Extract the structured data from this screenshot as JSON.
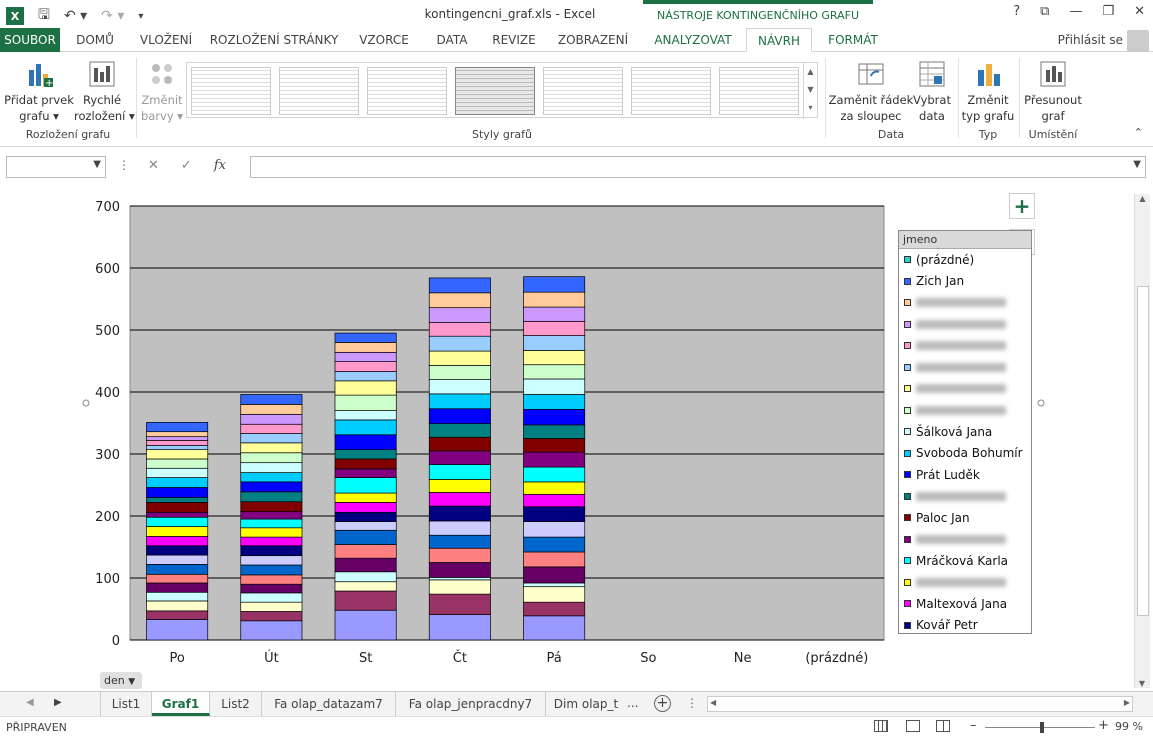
{
  "titlebar": {
    "doc_title": "kontingencni_graf.xls - Excel",
    "context_title": "NÁSTROJE KONTINGENČNÍHO GRAFU",
    "help": "?",
    "restore": "⧉",
    "minimize": "—",
    "maximize": "❐",
    "close": "✕"
  },
  "tabs": {
    "file": "SOUBOR",
    "items": [
      "DOMŮ",
      "VLOŽENÍ",
      "ROZLOŽENÍ STRÁNKY",
      "VZORCE",
      "DATA",
      "REVIZE",
      "ZOBRAZENÍ",
      "ANALYZOVAT",
      "NÁVRH",
      "FORMÁT"
    ],
    "signin": "Přihlásit se"
  },
  "ribbon": {
    "add_element": "Přidat prvek\ngrafu ▾",
    "quick_layout": "Rychlé\nrozložení ▾",
    "change_colors": "Změnit\nbarvy ▾",
    "switch_row_col": "Zaměnit řádek\nza sloupec",
    "select_data": "Vybrat\ndata",
    "change_type": "Změnit\ntyp grafu",
    "move_chart": "Přesunout\ngraf",
    "group_layout": "Rozložení grafu",
    "group_styles": "Styly grafů",
    "group_data": "Data",
    "group_type": "Typ",
    "group_location": "Umístění"
  },
  "formula_bar": {
    "name_box": "",
    "formula": ""
  },
  "chart_data": {
    "type": "bar",
    "stacked": true,
    "categories": [
      "Po",
      "Út",
      "St",
      "Čt",
      "Pá",
      "So",
      "Ne",
      "(prázdné)"
    ],
    "ylim": [
      0,
      700
    ],
    "yticks": [
      0,
      100,
      200,
      300,
      400,
      500,
      600,
      700
    ],
    "grid": true,
    "legend_title": "jmeno",
    "legend_placement": "right",
    "field_button": "den",
    "series": [
      {
        "name": "Kovář Petr",
        "color": "#9999ff",
        "values": [
          33,
          31,
          48,
          41,
          39,
          0,
          0,
          0
        ]
      },
      {
        "name": "",
        "color": "#993366",
        "values": [
          14,
          15,
          31,
          33,
          22,
          0,
          0,
          0
        ]
      },
      {
        "name": "",
        "color": "#ffffcc",
        "values": [
          16,
          15,
          15,
          23,
          25,
          0,
          0,
          0
        ]
      },
      {
        "name": "",
        "color": "#ccffff",
        "values": [
          14,
          15,
          16,
          4,
          6,
          0,
          0,
          0
        ]
      },
      {
        "name": "",
        "color": "#660066",
        "values": [
          15,
          14,
          22,
          24,
          26,
          0,
          0,
          0
        ]
      },
      {
        "name": "",
        "color": "#ff8080",
        "values": [
          14,
          15,
          22,
          23,
          24,
          0,
          0,
          0
        ]
      },
      {
        "name": "",
        "color": "#0066cc",
        "values": [
          16,
          16,
          23,
          21,
          24,
          0,
          0,
          0
        ]
      },
      {
        "name": "",
        "color": "#ccccff",
        "values": [
          15,
          15,
          14,
          23,
          25,
          0,
          0,
          0
        ]
      },
      {
        "name": "",
        "color": "#000080",
        "values": [
          15,
          16,
          15,
          24,
          24,
          0,
          0,
          0
        ]
      },
      {
        "name": "Maltexová Jana",
        "color": "#ff00ff",
        "values": [
          15,
          14,
          16,
          22,
          20,
          0,
          0,
          0
        ]
      },
      {
        "name": "",
        "color": "#ffff00",
        "values": [
          16,
          15,
          15,
          21,
          20,
          0,
          0,
          0
        ]
      },
      {
        "name": "Mráčková Karla",
        "color": "#00ffff",
        "values": [
          15,
          14,
          25,
          24,
          24,
          0,
          0,
          0
        ]
      },
      {
        "name": "",
        "color": "#800080",
        "values": [
          8,
          12,
          14,
          22,
          24,
          0,
          0,
          0
        ]
      },
      {
        "name": "Paloc Jan",
        "color": "#800000",
        "values": [
          16,
          16,
          16,
          22,
          22,
          0,
          0,
          0
        ]
      },
      {
        "name": "",
        "color": "#008080",
        "values": [
          8,
          16,
          15,
          22,
          22,
          0,
          0,
          0
        ]
      },
      {
        "name": "Prát Luděk",
        "color": "#0000ff",
        "values": [
          16,
          16,
          24,
          24,
          25,
          0,
          0,
          0
        ]
      },
      {
        "name": "Svoboda Bohumír",
        "color": "#00ccff",
        "values": [
          16,
          15,
          24,
          24,
          24,
          0,
          0,
          0
        ]
      },
      {
        "name": "Šálková Jana",
        "color": "#ccffff",
        "values": [
          15,
          16,
          15,
          23,
          25,
          0,
          0,
          0
        ]
      },
      {
        "name": "",
        "color": "#ccffcc",
        "values": [
          15,
          16,
          25,
          23,
          23,
          0,
          0,
          0
        ]
      },
      {
        "name": "",
        "color": "#ffff99",
        "values": [
          15,
          16,
          23,
          23,
          23,
          0,
          0,
          0
        ]
      },
      {
        "name": "",
        "color": "#99ccff",
        "values": [
          7,
          15,
          15,
          24,
          24,
          0,
          0,
          0
        ]
      },
      {
        "name": "",
        "color": "#ff99cc",
        "values": [
          8,
          15,
          16,
          22,
          23,
          0,
          0,
          0
        ]
      },
      {
        "name": "",
        "color": "#cc99ff",
        "values": [
          6,
          16,
          15,
          24,
          23,
          0,
          0,
          0
        ]
      },
      {
        "name": "",
        "color": "#ffcc99",
        "values": [
          8,
          16,
          16,
          24,
          24,
          0,
          0,
          0
        ]
      },
      {
        "name": "Zich Jan",
        "color": "#3366ff",
        "values": [
          15,
          16,
          15,
          24,
          25,
          0,
          0,
          0
        ]
      }
    ],
    "legend_entries": [
      {
        "name": "(prázdné)",
        "color": "#33cccc",
        "blurred": false
      },
      {
        "name": "Zich Jan",
        "color": "#3366ff",
        "blurred": false
      },
      {
        "name": "",
        "color": "#ffcc99",
        "blurred": true
      },
      {
        "name": "",
        "color": "#cc99ff",
        "blurred": true
      },
      {
        "name": "",
        "color": "#ff99cc",
        "blurred": true
      },
      {
        "name": "",
        "color": "#99ccff",
        "blurred": true
      },
      {
        "name": "",
        "color": "#ffff99",
        "blurred": true
      },
      {
        "name": "",
        "color": "#ccffcc",
        "blurred": true
      },
      {
        "name": "Šálková Jana",
        "color": "#ccffff",
        "blurred": false
      },
      {
        "name": "Svoboda Bohumír",
        "color": "#00ccff",
        "blurred": false
      },
      {
        "name": "Prát Luděk",
        "color": "#0000ff",
        "blurred": false
      },
      {
        "name": "",
        "color": "#008080",
        "blurred": true
      },
      {
        "name": "Paloc Jan",
        "color": "#800000",
        "blurred": false
      },
      {
        "name": "",
        "color": "#800080",
        "blurred": true
      },
      {
        "name": "Mráčková Karla",
        "color": "#00ffff",
        "blurred": false
      },
      {
        "name": "",
        "color": "#ffff00",
        "blurred": true
      },
      {
        "name": "Maltexová Jana",
        "color": "#ff00ff",
        "blurred": false
      },
      {
        "name": "Kovář Petr",
        "color": "#000080",
        "blurred": false
      }
    ]
  },
  "sheet_tabs": {
    "tabs": [
      "List1",
      "Graf1",
      "List2",
      "Fa olap_datazam7",
      "Fa olap_jenpracdny7",
      "Dim olap_t"
    ],
    "active": "Graf1",
    "more": "..."
  },
  "status": {
    "ready": "PŘIPRAVEN",
    "zoom": "99 %"
  },
  "colors": {
    "accent": "#1d7044",
    "plot_bg": "#c0c0c0"
  }
}
